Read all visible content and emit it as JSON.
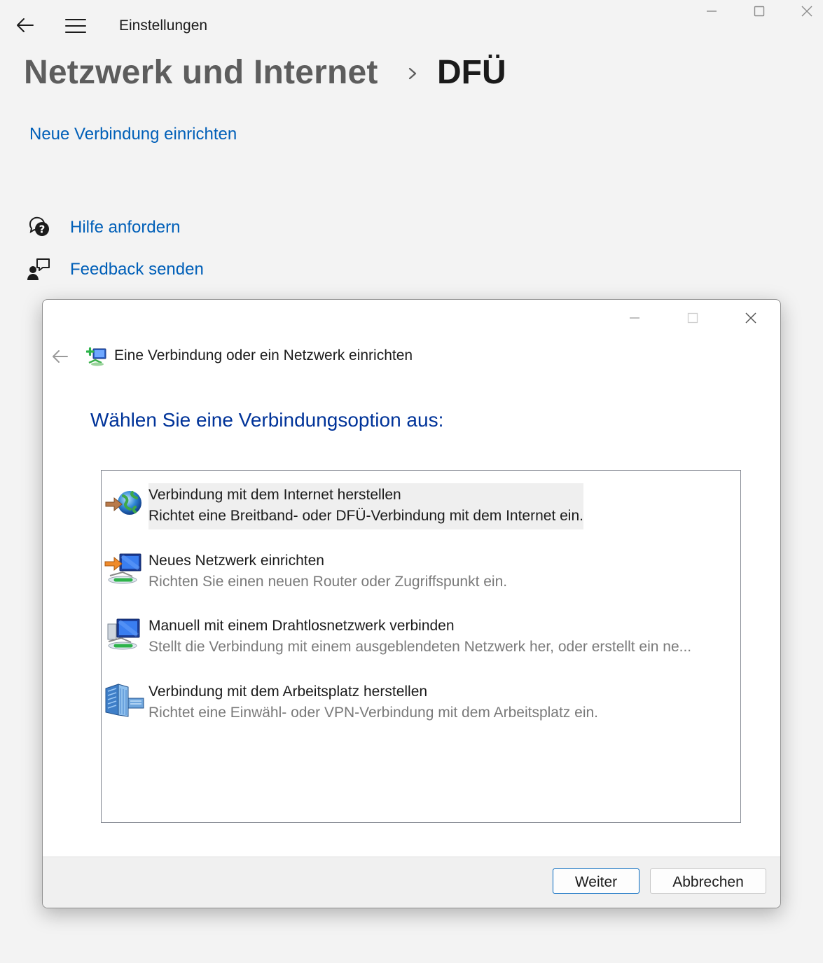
{
  "window": {
    "app_title": "Einstellungen"
  },
  "page": {
    "breadcrumb_parent": "Netzwerk und Internet",
    "breadcrumb_current": "DFÜ",
    "new_connection_link": "Neue Verbindung einrichten",
    "help_link": "Hilfe anfordern",
    "feedback_link": "Feedback senden"
  },
  "dialog": {
    "title": "Eine Verbindung oder ein Netzwerk einrichten",
    "heading": "Wählen Sie eine Verbindungsoption aus:",
    "options": [
      {
        "title": "Verbindung mit dem Internet herstellen",
        "description": "Richtet eine Breitband- oder DFÜ-Verbindung mit dem Internet ein.",
        "icon": "globe-arrow-icon",
        "selected": true
      },
      {
        "title": "Neues Netzwerk einrichten",
        "description": "Richten Sie einen neuen Router oder Zugriffspunkt ein.",
        "icon": "network-setup-icon",
        "selected": false
      },
      {
        "title": "Manuell mit einem Drahtlosnetzwerk verbinden",
        "description": "Stellt die Verbindung mit einem ausgeblendeten Netzwerk her, oder erstellt ein ne...",
        "icon": "wireless-network-icon",
        "selected": false
      },
      {
        "title": "Verbindung mit dem Arbeitsplatz herstellen",
        "description": "Richtet eine Einwähl- oder VPN-Verbindung mit dem Arbeitsplatz ein.",
        "icon": "workplace-building-icon",
        "selected": false
      }
    ],
    "next_button": "Weiter",
    "cancel_button": "Abbrechen"
  },
  "colors": {
    "accent_link": "#005fb8",
    "dialog_heading": "#003399",
    "selection_bg": "#efefef"
  }
}
